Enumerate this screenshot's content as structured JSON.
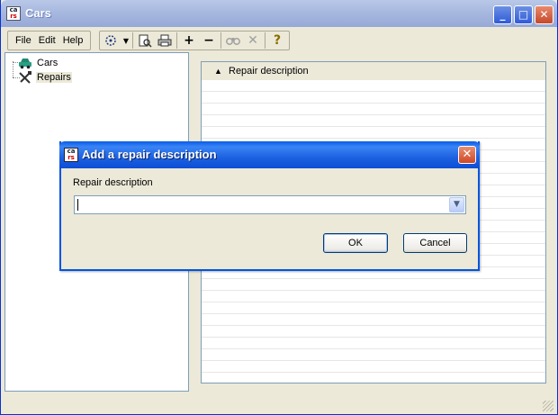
{
  "window": {
    "title": "Cars",
    "icon_top": "ca",
    "icon_bottom": "rs",
    "controls": {
      "minimize": "_",
      "maximize": "□",
      "close": "✕"
    }
  },
  "menu": [
    "File",
    "Edit",
    "Help"
  ],
  "toolbar": {
    "icons": [
      "filter-icon",
      "dropdown-arrow-icon",
      "print-preview-icon",
      "print-icon",
      "add-icon",
      "remove-icon",
      "find-icon",
      "delete-icon",
      "help-icon"
    ],
    "add_glyph": "+",
    "remove_glyph": "−",
    "delete_glyph": "✕",
    "help_glyph": "?"
  },
  "tree": {
    "items": [
      {
        "label": "Cars",
        "icon": "car-icon"
      },
      {
        "label": "Repairs",
        "icon": "tools-icon",
        "selected": true
      }
    ]
  },
  "table": {
    "sort_indicator": "▲",
    "columns": [
      "Repair description"
    ]
  },
  "dialog": {
    "title": "Add a repair description",
    "field_label": "Repair description",
    "field_value": "",
    "ok_label": "OK",
    "cancel_label": "Cancel",
    "close_glyph": "✕"
  },
  "colors": {
    "window_bg": "#ece9d8",
    "dialog_title": "#0c4ed6",
    "inactive_title": "#a7b8df",
    "border_blue": "#7f9db9"
  }
}
